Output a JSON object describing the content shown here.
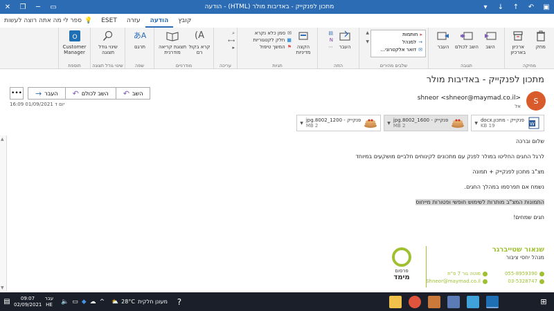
{
  "window": {
    "title": "מתכון לפנקייק - באדיבות מולר (HTML) - הודעה",
    "controls": [
      "close",
      "maximize",
      "minimize"
    ],
    "quick_access": [
      "up-arrow",
      "down-arrow",
      "more"
    ]
  },
  "tabs": [
    {
      "label": "קובץ",
      "active": false
    },
    {
      "label": "הודעה",
      "active": true
    },
    {
      "label": "עזרה",
      "active": false
    },
    {
      "label": "ESET",
      "active": false
    }
  ],
  "tellme": "ספר לי מה אתה רוצה לעשות",
  "ribbon": {
    "groups": [
      {
        "label": "מחיקה",
        "buttons": [
          "מחק",
          "ארכיון בארכיון"
        ]
      },
      {
        "label": "תגובה",
        "buttons": [
          "השב",
          "השב לכולם",
          "העבר"
        ]
      },
      {
        "label": "שלבים מהירים",
        "items": [
          "חותמות",
          "למנהל",
          "דואר אלקטרוני..."
        ]
      },
      {
        "label": "הזזה",
        "buttons": [
          "העבר"
        ]
      },
      {
        "label": "תגיות",
        "buttons": [
          "הקצה מדיניות"
        ],
        "small": [
          "סמן כלא נקרא",
          "חלק לקטגוריות",
          "המשך טיפול"
        ]
      },
      {
        "label": "עריכה",
        "buttons": []
      },
      {
        "label": "מודרניים",
        "buttons": [
          "קרא בקול רם",
          "תצוגת קריאה מודרנית"
        ]
      },
      {
        "label": "שפה",
        "buttons": [
          "תרגם"
        ]
      },
      {
        "label": "שינוי גודל תצוגה",
        "buttons": [
          "שינוי גודל תצוגה"
        ]
      },
      {
        "label": "תוספת",
        "buttons": [
          "Customer Manager"
        ]
      }
    ]
  },
  "message": {
    "subject": "מתכון לפנקייק - באדיבות מולר",
    "sender": "shneor <shneor@maymad.co.il>",
    "to_label": "אל",
    "avatar_letter": "S",
    "date": "יום ד 01/09/2021 16:09",
    "actions": {
      "reply": "השב",
      "reply_all": "השב לכולם",
      "forward": "העבר"
    }
  },
  "attachments": [
    {
      "name": "פנקייק - מתכון.docx",
      "size": "19 KB",
      "type": "word",
      "selected": false
    },
    {
      "name": "פנקייק - 1600_8002.jpg",
      "size": "2 MB",
      "type": "image",
      "selected": true
    },
    {
      "name": "פנקייק - 1200_8002.jpg",
      "size": "2 MB",
      "type": "image",
      "selected": false
    }
  ],
  "body": {
    "lines": [
      "שלום וברכה",
      "לרגל החגים החליטו במולר לפנק עם מתכונים לקינוחים חלביים מושקעים במיוחד",
      "מצ\"ב מתכון לפנקייק + תמונה",
      "נשמח אם תפרסמו במהלך החגים."
    ],
    "highlighted": "התמונות המצ\"ב מותרות לשימוש חופשי ופטורות מייחוס",
    "closing": "חגים שמחים!"
  },
  "signature": {
    "name": "שנאור שטייברגר",
    "role": "מנהל יחסי ציבור",
    "phone1": "055-8959390",
    "phone2": "03-5328747",
    "address": "מוטה גור 7 פ\"ת",
    "email": "Shneor@maymad.co.il",
    "logo_top": "פרסום",
    "logo_bottom": "מימד"
  },
  "taskbar": {
    "time": "09:07",
    "date": "02/09/2021",
    "lang1": "עבר",
    "lang2": "HE",
    "weather": "28°C",
    "weather_text": "מעונן חלקית"
  },
  "colors": {
    "titlebar": "#2b6cb5",
    "accent": "#2b6cb5",
    "avatar": "#d95b2b",
    "signature_green": "#a0c032",
    "taskbar": "#1b1f2a"
  }
}
